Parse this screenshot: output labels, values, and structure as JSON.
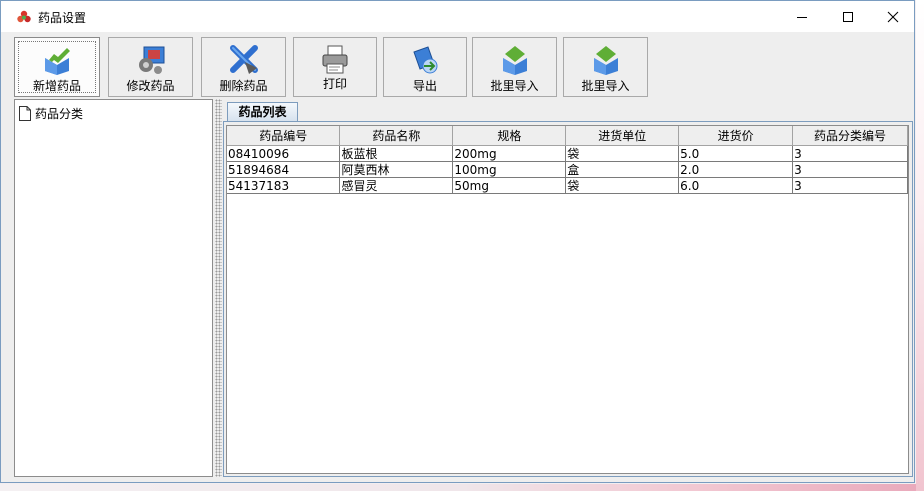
{
  "window": {
    "title": "药品设置"
  },
  "toolbar": {
    "buttons": [
      {
        "label": "新增药品",
        "icon": "add-drug-icon"
      },
      {
        "label": "修改药品",
        "icon": "edit-drug-icon"
      },
      {
        "label": "删除药品",
        "icon": "delete-drug-icon"
      },
      {
        "label": "打印",
        "icon": "printer-icon"
      },
      {
        "label": "导出",
        "icon": "export-icon"
      },
      {
        "label": "批里导入",
        "icon": "import-icon"
      },
      {
        "label": "批里导入",
        "icon": "import-icon"
      }
    ]
  },
  "tree": {
    "root_label": "药品分类"
  },
  "tabs": {
    "active": "药品列表"
  },
  "table": {
    "columns": [
      "药品编号",
      "药品名称",
      "规格",
      "进货单位",
      "进货价",
      "药品分类编号"
    ],
    "rows": [
      [
        "08410096",
        "板蓝根",
        "200mg",
        "袋",
        "5.0",
        "3"
      ],
      [
        "51894684",
        "阿莫西林",
        "100mg",
        "盒",
        "2.0",
        "3"
      ],
      [
        "54137183",
        "感冒灵",
        "50mg",
        "袋",
        "6.0",
        "3"
      ]
    ]
  },
  "colors": {
    "accent_border": "#7d9cbd",
    "window_bg": "#eeeeee",
    "icon_green": "#5fae36",
    "icon_blue": "#3c7fd6"
  }
}
